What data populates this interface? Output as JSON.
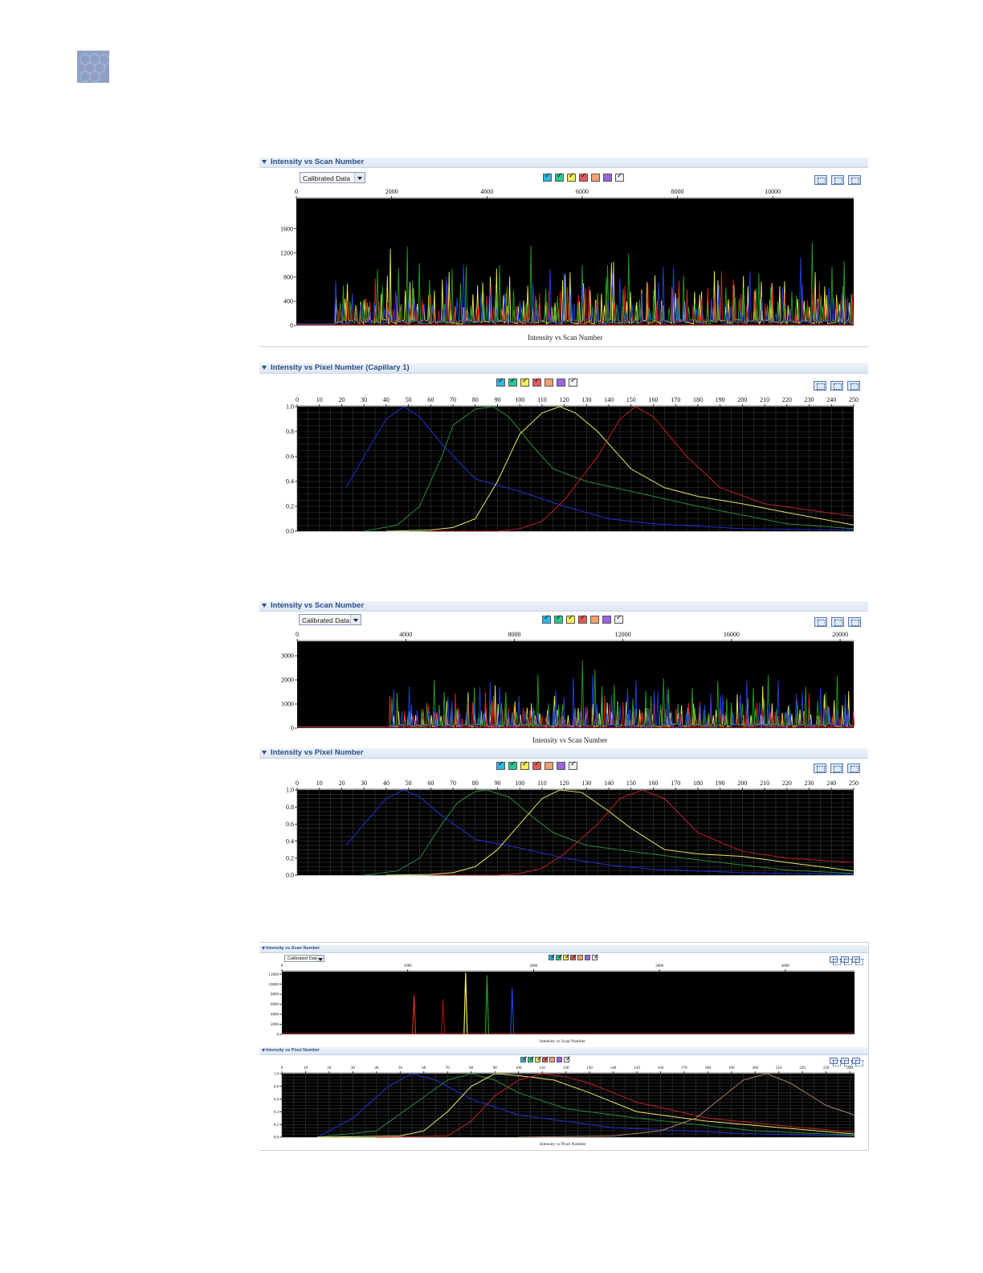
{
  "dye_colors": [
    "#2fb6e8",
    "#2ac890",
    "#f2ee54",
    "#e65858",
    "#f5a070",
    "#9a63e0",
    "#f0f0f0"
  ],
  "screenshots": [
    {
      "scan": {
        "title": "Intensity vs Scan Number",
        "dropdown": "Calibrated Data",
        "x_ticks": [
          "0",
          "2000",
          "4000",
          "6000",
          "8000",
          "10000"
        ],
        "y_ticks": [
          "1600",
          "1200",
          "800",
          "400",
          "0"
        ],
        "caption": "Intensity vs Scan Number"
      },
      "pixel": {
        "title": "Intensity vs Pixel Number (Capillary 1)",
        "x_ticks": [
          "0",
          "10",
          "20",
          "30",
          "40",
          "50",
          "60",
          "70",
          "80",
          "90",
          "100",
          "110",
          "120",
          "130",
          "140",
          "150",
          "160",
          "170",
          "180",
          "190",
          "200",
          "210",
          "220",
          "230",
          "240",
          "250"
        ],
        "y_ticks": [
          "1.0",
          "0.8",
          "0.6",
          "0.4",
          "0.2",
          "0.0"
        ],
        "caption": ""
      }
    },
    {
      "scan": {
        "title": "Intensity vs Scan Number",
        "dropdown": "Calibrated Data",
        "x_ticks": [
          "0",
          "4000",
          "8000",
          "12000",
          "16000",
          "20000"
        ],
        "y_ticks": [
          "3000",
          "2000",
          "1000",
          "0"
        ],
        "caption": "Intensity vs Scan Number"
      },
      "pixel": {
        "title": "Intensity vs Pixel Number",
        "x_ticks": [
          "0",
          "10",
          "20",
          "30",
          "40",
          "50",
          "60",
          "70",
          "80",
          "90",
          "100",
          "110",
          "120",
          "130",
          "140",
          "150",
          "160",
          "170",
          "180",
          "190",
          "200",
          "210",
          "220",
          "230",
          "240",
          "250"
        ],
        "y_ticks": [
          "1.0",
          "0.8",
          "0.6",
          "0.4",
          "0.2",
          "0.0"
        ],
        "caption": ""
      }
    },
    {
      "scan": {
        "title": "Intensity vs Scan Number",
        "dropdown": "Calibrated Data",
        "x_ticks": [
          "0",
          "1000",
          "2000",
          "3000",
          "4000"
        ],
        "y_ticks": [
          "12000",
          "10000",
          "8000",
          "6000",
          "4000",
          "2000",
          "0"
        ],
        "caption": "Intensity vs Scan Number"
      },
      "pixel": {
        "title": "Intensity vs Pixel Number",
        "x_ticks": [
          "0",
          "10",
          "20",
          "30",
          "40",
          "50",
          "60",
          "70",
          "80",
          "90",
          "100",
          "110",
          "120",
          "130",
          "140",
          "150",
          "160",
          "170",
          "180",
          "190",
          "200",
          "210",
          "220",
          "230",
          "240"
        ],
        "y_ticks": [
          "1.0",
          "0.8",
          "0.6",
          "0.4",
          "0.2",
          "0.0"
        ],
        "caption": "Intensity vs Pixel Number"
      }
    }
  ],
  "chart_data": [
    {
      "type": "line",
      "title": "Intensity vs Scan Number",
      "xlabel": "Intensity vs Scan Number",
      "ylabel": "",
      "xlim": [
        0,
        11700
      ],
      "ylim": [
        0,
        2100
      ],
      "grid": false,
      "series": [
        {
          "color": "#f2ee54",
          "peaks": {
            "start": 800,
            "end": 11700,
            "count": 95,
            "min": 300,
            "max": 1400
          }
        },
        {
          "color": "#e02020",
          "peaks": {
            "start": 800,
            "end": 11700,
            "count": 95,
            "min": 250,
            "max": 1100
          }
        },
        {
          "color": "#22a022",
          "peaks": {
            "start": 800,
            "end": 11700,
            "count": 80,
            "min": 300,
            "max": 1750
          }
        },
        {
          "color": "#2040e0",
          "peaks": {
            "start": 800,
            "end": 11700,
            "count": 70,
            "min": 200,
            "max": 1300
          }
        }
      ]
    },
    {
      "type": "line",
      "title": "Intensity vs Pixel Number (Capillary 1)",
      "xlim": [
        0,
        250
      ],
      "ylim": [
        0,
        1
      ],
      "grid": true,
      "series": [
        {
          "color": "#2030d0",
          "x": [
            22,
            30,
            40,
            48,
            55,
            65,
            80,
            100,
            120,
            140,
            160,
            200,
            250
          ],
          "y": [
            0.35,
            0.6,
            0.9,
            1.0,
            0.92,
            0.7,
            0.42,
            0.32,
            0.2,
            0.1,
            0.06,
            0.02,
            0.01
          ]
        },
        {
          "color": "#2a8a3a",
          "x": [
            30,
            45,
            55,
            65,
            70,
            80,
            88,
            95,
            105,
            115,
            130,
            150,
            180,
            220,
            250
          ],
          "y": [
            0.0,
            0.05,
            0.2,
            0.6,
            0.85,
            0.98,
            1.0,
            0.92,
            0.7,
            0.5,
            0.4,
            0.32,
            0.2,
            0.06,
            0.02
          ]
        },
        {
          "color": "#e8e860",
          "x": [
            40,
            60,
            70,
            80,
            90,
            100,
            110,
            118,
            125,
            135,
            150,
            165,
            180,
            200,
            220,
            250
          ],
          "y": [
            0.0,
            0.01,
            0.03,
            0.1,
            0.4,
            0.78,
            0.95,
            1.0,
            0.95,
            0.8,
            0.5,
            0.35,
            0.28,
            0.22,
            0.15,
            0.05
          ]
        },
        {
          "color": "#c02020",
          "x": [
            60,
            90,
            100,
            110,
            120,
            135,
            145,
            152,
            160,
            175,
            190,
            210,
            230,
            250
          ],
          "y": [
            0.0,
            0.0,
            0.02,
            0.08,
            0.25,
            0.6,
            0.9,
            1.0,
            0.92,
            0.6,
            0.35,
            0.22,
            0.17,
            0.12
          ]
        }
      ]
    },
    {
      "type": "line",
      "title": "Intensity vs Scan Number",
      "xlabel": "Intensity vs Scan Number",
      "ylabel": "",
      "xlim": [
        0,
        20500
      ],
      "ylim": [
        0,
        3600
      ],
      "grid": false,
      "series": [
        {
          "color": "#f2ee54",
          "peaks": {
            "start": 3400,
            "end": 20500,
            "count": 90,
            "min": 500,
            "max": 2100
          }
        },
        {
          "color": "#e02020",
          "peaks": {
            "start": 3400,
            "end": 20500,
            "count": 90,
            "min": 400,
            "max": 2000
          }
        },
        {
          "color": "#22a022",
          "peaks": {
            "start": 3400,
            "end": 20500,
            "count": 70,
            "min": 600,
            "max": 3300
          }
        },
        {
          "color": "#2040e0",
          "peaks": {
            "start": 3400,
            "end": 20500,
            "count": 70,
            "min": 600,
            "max": 2800
          }
        }
      ]
    },
    {
      "type": "line",
      "title": "Intensity vs Pixel Number",
      "xlim": [
        0,
        250
      ],
      "ylim": [
        0,
        1
      ],
      "grid": true,
      "series": [
        {
          "color": "#2030d0",
          "x": [
            22,
            30,
            40,
            48,
            55,
            65,
            80,
            100,
            120,
            140,
            160,
            200,
            250
          ],
          "y": [
            0.35,
            0.6,
            0.9,
            1.0,
            0.92,
            0.7,
            0.42,
            0.32,
            0.2,
            0.12,
            0.07,
            0.03,
            0.01
          ]
        },
        {
          "color": "#2a8a3a",
          "x": [
            30,
            45,
            55,
            65,
            72,
            80,
            85,
            95,
            105,
            115,
            130,
            150,
            180,
            220,
            250
          ],
          "y": [
            0.0,
            0.05,
            0.2,
            0.6,
            0.85,
            0.98,
            1.0,
            0.92,
            0.7,
            0.5,
            0.35,
            0.28,
            0.18,
            0.06,
            0.02
          ]
        },
        {
          "color": "#e8e860",
          "x": [
            40,
            60,
            70,
            80,
            90,
            100,
            110,
            118,
            128,
            140,
            150,
            165,
            180,
            200,
            220,
            250
          ],
          "y": [
            0.0,
            0.01,
            0.03,
            0.1,
            0.3,
            0.6,
            0.9,
            1.0,
            0.97,
            0.75,
            0.55,
            0.3,
            0.25,
            0.22,
            0.15,
            0.05
          ]
        },
        {
          "color": "#c02020",
          "x": [
            60,
            90,
            100,
            110,
            120,
            135,
            145,
            155,
            165,
            180,
            200,
            220,
            250
          ],
          "y": [
            0.0,
            0.0,
            0.02,
            0.08,
            0.25,
            0.6,
            0.9,
            1.0,
            0.9,
            0.5,
            0.28,
            0.2,
            0.15
          ]
        }
      ]
    },
    {
      "type": "line",
      "title": "Intensity vs Scan Number",
      "xlabel": "Intensity vs Scan Number",
      "ylabel": "",
      "xlim": [
        0,
        4550
      ],
      "ylim": [
        0,
        12500
      ],
      "grid": false,
      "series": [
        {
          "color": "#d03020",
          "x": [
            1050
          ],
          "y": [
            7800
          ]
        },
        {
          "color": "#a01010",
          "x": [
            1280
          ],
          "y": [
            7000
          ]
        },
        {
          "color": "#f2ee54",
          "x": [
            1460
          ],
          "y": [
            12300
          ]
        },
        {
          "color": "#22a022",
          "x": [
            1630
          ],
          "y": [
            11800
          ]
        },
        {
          "color": "#2040e0",
          "x": [
            1830
          ],
          "y": [
            9200
          ]
        }
      ]
    },
    {
      "type": "line",
      "title": "Intensity vs Pixel Number",
      "xlabel": "Intensity vs Pixel Number",
      "xlim": [
        0,
        242
      ],
      "ylim": [
        0,
        1
      ],
      "grid": true,
      "series": [
        {
          "color": "#2030d0",
          "x": [
            15,
            30,
            45,
            55,
            65,
            80,
            100,
            140,
            200,
            242
          ],
          "y": [
            0.0,
            0.3,
            0.8,
            1.0,
            0.9,
            0.6,
            0.35,
            0.15,
            0.05,
            0.02
          ]
        },
        {
          "color": "#2a8a3a",
          "x": [
            15,
            40,
            55,
            70,
            80,
            90,
            100,
            120,
            150,
            200,
            242
          ],
          "y": [
            0.0,
            0.1,
            0.5,
            0.9,
            1.0,
            0.9,
            0.7,
            0.45,
            0.3,
            0.1,
            0.03
          ]
        },
        {
          "color": "#e8e860",
          "x": [
            15,
            50,
            60,
            70,
            80,
            90,
            100,
            115,
            130,
            150,
            180,
            220,
            242
          ],
          "y": [
            0.0,
            0.02,
            0.1,
            0.4,
            0.8,
            1.0,
            0.97,
            0.9,
            0.7,
            0.4,
            0.25,
            0.12,
            0.05
          ]
        },
        {
          "color": "#c02020",
          "x": [
            40,
            70,
            80,
            90,
            100,
            110,
            120,
            130,
            150,
            180,
            220,
            242
          ],
          "y": [
            0.0,
            0.02,
            0.25,
            0.65,
            0.9,
            1.0,
            0.95,
            0.85,
            0.55,
            0.3,
            0.15,
            0.08
          ]
        },
        {
          "color": "#b08060",
          "x": [
            100,
            140,
            160,
            175,
            185,
            195,
            205,
            215,
            230,
            242
          ],
          "y": [
            0.0,
            0.02,
            0.1,
            0.3,
            0.6,
            0.9,
            1.0,
            0.85,
            0.5,
            0.35
          ]
        }
      ]
    }
  ]
}
